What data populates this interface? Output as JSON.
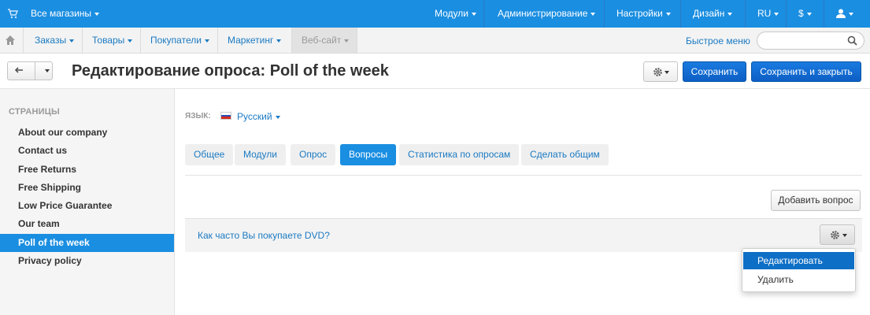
{
  "topbar": {
    "stores_label": "Все магазины",
    "menus": [
      "Модули",
      "Администрирование",
      "Настройки",
      "Дизайн"
    ],
    "language": "RU",
    "currency": "$"
  },
  "nav": {
    "items": [
      "Заказы",
      "Товары",
      "Покупатели",
      "Маркетинг",
      "Веб-сайт"
    ],
    "quick_menu": "Быстрое меню",
    "search_placeholder": ""
  },
  "header": {
    "title": "Редактирование опроса: Poll of the week",
    "save": "Сохранить",
    "save_close": "Сохранить и закрыть"
  },
  "sidebar": {
    "heading": "СТРАНИЦЫ",
    "items": [
      "About our company",
      "Contact us",
      "Free Returns",
      "Free Shipping",
      "Low Price Guarantee",
      "Our team",
      "Poll of the week",
      "Privacy policy"
    ],
    "active_index": 6
  },
  "main": {
    "language_label": "ЯЗЫК:",
    "language_value": "Русский",
    "tabs": [
      "Общее",
      "Модули",
      "Опрос",
      "Вопросы",
      "Статистика по опросам",
      "Сделать общим"
    ],
    "active_tab": "Вопросы",
    "add_question": "Добавить вопрос",
    "question": "Как часто Вы покупаете DVD?",
    "menu": [
      "Редактировать",
      "Удалить"
    ]
  },
  "colors": {
    "topbar": "#1a8ee1",
    "accent": "#1a8ee1",
    "link": "#1b7ac2",
    "primary_button": "#0d5fc4"
  }
}
